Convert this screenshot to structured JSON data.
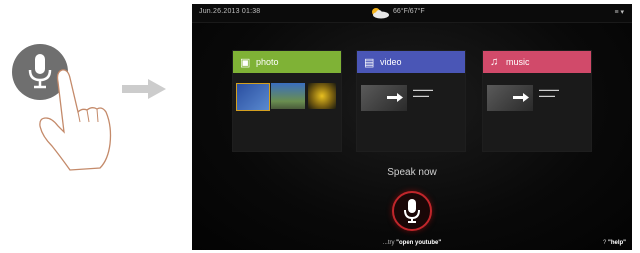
{
  "tv": {
    "datetime": "Jun.26.2013  01:38",
    "temperature": "66°F/67°F",
    "top_right": "≡ ▾",
    "cards": [
      {
        "label": "photo",
        "color": "#7fb236",
        "icon": "photo-icon"
      },
      {
        "label": "video",
        "color": "#4a56b6",
        "icon": "film-icon"
      },
      {
        "label": "music",
        "color": "#d14a6a",
        "icon": "music-note-icon"
      }
    ],
    "speak_prompt": "Speak now",
    "say_prefix": "...try ",
    "say_query": "\"open youtube\"",
    "help_mark": "?",
    "help_label": "\"help\""
  },
  "colors": {
    "mic_ring": "#c0262b",
    "mic_button_gray": "#6f6f6f",
    "arrow_gray": "#cccccc"
  }
}
